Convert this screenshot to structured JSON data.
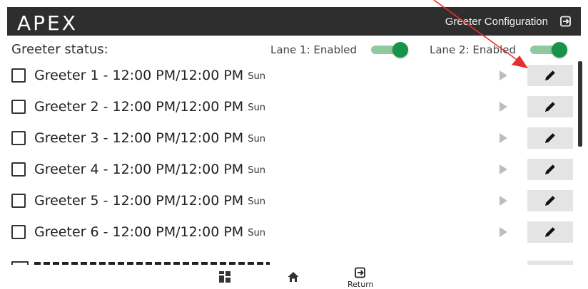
{
  "header": {
    "logo_text": "APEX",
    "title": "Greeter Configuration",
    "logout_icon": "logout-icon",
    "background_color": "#2e2e2e"
  },
  "status": {
    "label": "Greeter status:",
    "lanes": [
      {
        "label": "Lane 1: Enabled",
        "enabled": true
      },
      {
        "label": "Lane 2: Enabled",
        "enabled": true
      }
    ],
    "toggle_on_color": "#16954a"
  },
  "greeters": [
    {
      "checked": false,
      "name": "Greeter 1 - 12:00 PM/12:00 PM",
      "day": "Sun"
    },
    {
      "checked": false,
      "name": "Greeter 2 - 12:00 PM/12:00 PM",
      "day": "Sun"
    },
    {
      "checked": false,
      "name": "Greeter 3 - 12:00 PM/12:00 PM",
      "day": "Sun"
    },
    {
      "checked": false,
      "name": "Greeter 4 - 12:00 PM/12:00 PM",
      "day": "Sun"
    },
    {
      "checked": false,
      "name": "Greeter 5 - 12:00 PM/12:00 PM",
      "day": "Sun"
    },
    {
      "checked": false,
      "name": "Greeter 6 - 12:00 PM/12:00 PM",
      "day": "Sun"
    }
  ],
  "row_icons": {
    "play": "play-icon",
    "edit": "pencil-icon"
  },
  "bottom_nav": {
    "items": [
      {
        "icon": "grid-icon",
        "label": ""
      },
      {
        "icon": "home-icon",
        "label": ""
      },
      {
        "icon": "return-icon",
        "label": "Return"
      }
    ]
  },
  "annotation": {
    "arrow_color": "#e8302a",
    "points_to": "edit-button of Greeter 1"
  }
}
